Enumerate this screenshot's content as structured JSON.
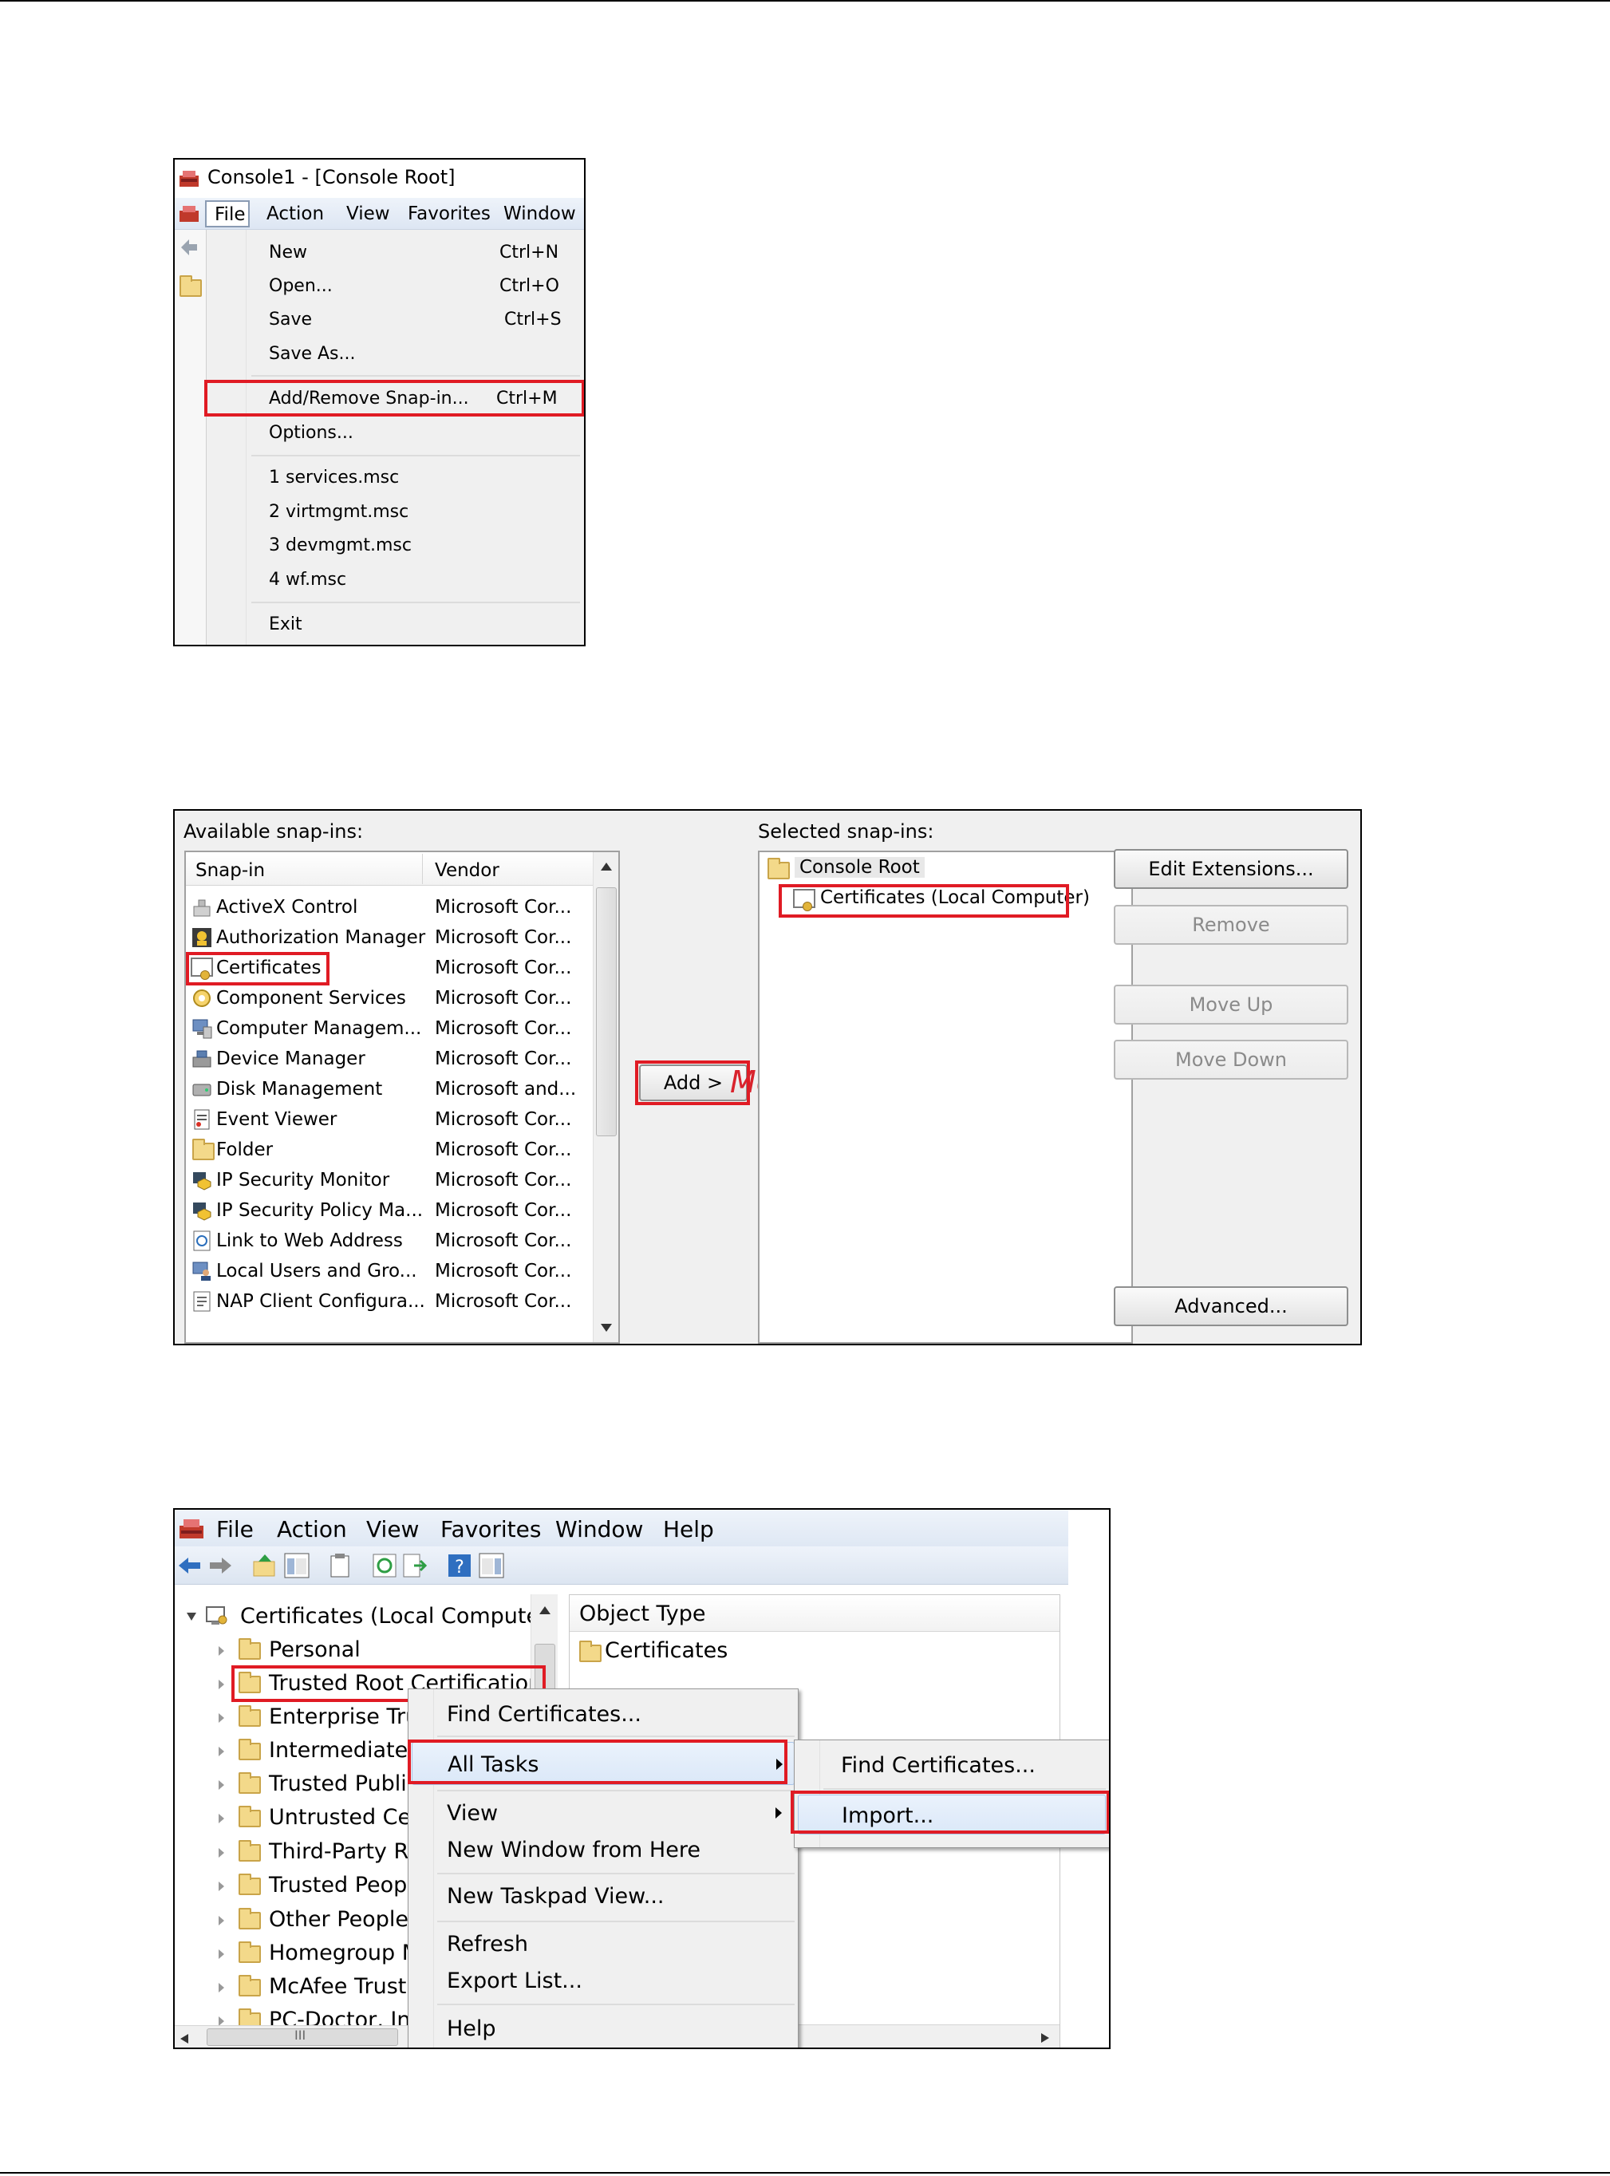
{
  "panel1": {
    "window_title": "Console1 - [Console Root]",
    "menubar": [
      "File",
      "Action",
      "View",
      "Favorites",
      "Window"
    ],
    "menu_items": [
      {
        "label": "New",
        "shortcut": "Ctrl+N"
      },
      {
        "label": "Open...",
        "shortcut": "Ctrl+O"
      },
      {
        "label": "Save",
        "shortcut": "Ctrl+S"
      },
      {
        "label": "Save As...",
        "shortcut": ""
      },
      {
        "label": "Add/Remove Snap-in...",
        "shortcut": "Ctrl+M"
      },
      {
        "label": "Options...",
        "shortcut": ""
      },
      {
        "label": "1 services.msc",
        "shortcut": ""
      },
      {
        "label": "2 virtmgmt.msc",
        "shortcut": ""
      },
      {
        "label": "3 devmgmt.msc",
        "shortcut": ""
      },
      {
        "label": "4 wf.msc",
        "shortcut": ""
      },
      {
        "label": "Exit",
        "shortcut": ""
      }
    ]
  },
  "panel2": {
    "available_label": "Available snap-ins:",
    "selected_label": "Selected snap-ins:",
    "col_snapin": "Snap-in",
    "col_vendor": "Vendor",
    "snapins": [
      {
        "name": "ActiveX Control",
        "vendor": "Microsoft Cor..."
      },
      {
        "name": "Authorization Manager",
        "vendor": "Microsoft Cor..."
      },
      {
        "name": "Certificates",
        "vendor": "Microsoft Cor..."
      },
      {
        "name": "Component Services",
        "vendor": "Microsoft Cor..."
      },
      {
        "name": "Computer Managem...",
        "vendor": "Microsoft Cor..."
      },
      {
        "name": "Device Manager",
        "vendor": "Microsoft Cor..."
      },
      {
        "name": "Disk Management",
        "vendor": "Microsoft and..."
      },
      {
        "name": "Event Viewer",
        "vendor": "Microsoft Cor..."
      },
      {
        "name": "Folder",
        "vendor": "Microsoft Cor..."
      },
      {
        "name": "IP Security Monitor",
        "vendor": "Microsoft Cor..."
      },
      {
        "name": "IP Security Policy Ma...",
        "vendor": "Microsoft Cor..."
      },
      {
        "name": "Link to Web Address",
        "vendor": "Microsoft Cor..."
      },
      {
        "name": "Local Users and Gro...",
        "vendor": "Microsoft Cor..."
      },
      {
        "name": "NAP Client Configura...",
        "vendor": "Microsoft Cor..."
      }
    ],
    "add_button": "Add >",
    "watermark": "McGrp.Ru",
    "selected_root": "Console Root",
    "selected_child": "Certificates (Local Computer)",
    "buttons": {
      "edit_extensions": "Edit Extensions...",
      "remove": "Remove",
      "move_up": "Move Up",
      "move_down": "Move Down",
      "advanced": "Advanced..."
    }
  },
  "panel3": {
    "menubar": [
      "File",
      "Action",
      "View",
      "Favorites",
      "Window",
      "Help"
    ],
    "tree_root": "Certificates (Local Computer",
    "tree_items": [
      "Personal",
      "Trusted Root Certification",
      "Enterprise Tru",
      "Intermediate",
      "Trusted Publis",
      "Untrusted Cer",
      "Third-Party Ro",
      "Trusted Peopl",
      "Other People",
      "Homegroup M",
      "McAfee Trust",
      "PC-Doctor, In"
    ],
    "object_type_header": "Object Type",
    "object_item": "Certificates",
    "context_menu": [
      "Find Certificates...",
      "All Tasks",
      "View",
      "New Window from Here",
      "New Taskpad View...",
      "Refresh",
      "Export List...",
      "Help"
    ],
    "submenu": [
      "Find Certificates...",
      "Import..."
    ],
    "hscroll_grip": "III"
  }
}
